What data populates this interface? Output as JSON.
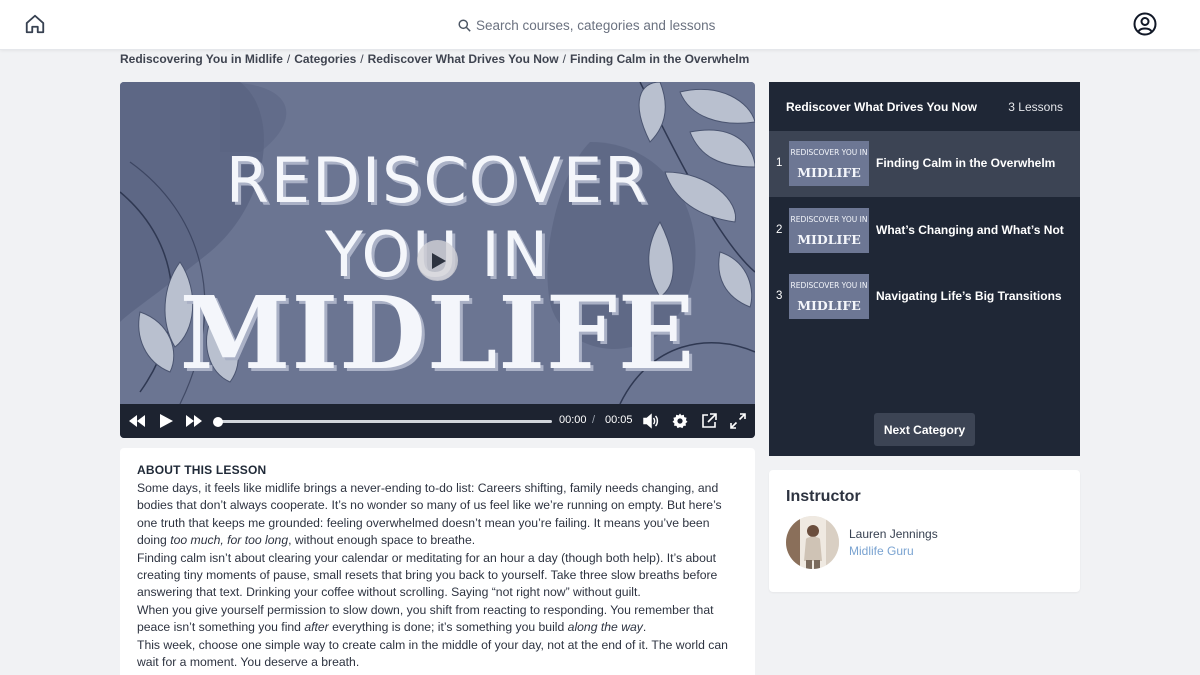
{
  "header": {
    "search_placeholder": "Search courses, categories and lessons",
    "home_icon": "home-icon",
    "account_icon": "user-circle-icon"
  },
  "breadcrumb": [
    "Rediscovering You in Midlife",
    "Categories",
    "Rediscover What Drives You Now",
    "Finding Calm in the Overwhelm"
  ],
  "video": {
    "title_line1": "REDISCOVER",
    "title_line2": "YOU IN",
    "title_line3": "MIDLIFE",
    "current_time": "00:00",
    "time_separator": "/",
    "duration": "00:05",
    "progress": 0
  },
  "about": {
    "heading": "ABOUT THIS LESSON",
    "p1_a": "Some days, it feels like midlife brings a never-ending to-do list: Careers shifting, family needs changing, and bodies that don’t always cooperate. It’s no wonder so many of us feel like we’re running on empty. But here’s one truth that keeps me grounded: feeling overwhelmed doesn’t mean you’re failing. It means you’ve been doing ",
    "p1_em": "too much, for too long",
    "p1_b": ", without enough space to breathe.",
    "p2": "Finding calm isn’t about clearing your calendar or meditating for an hour a day (though both help). It’s about creating tiny moments of pause, small resets that bring you back to yourself. Take three slow breaths before answering that text. Drinking your coffee without scrolling. Saying “not right now” without guilt.",
    "p3_a": "When you give yourself permission to slow down, you shift from reacting to responding. You remember that peace isn’t something you find ",
    "p3_em1": "after",
    "p3_b": " everything is done; it’s something you build ",
    "p3_em2": "along the way",
    "p3_c": ".",
    "p4": "This week, choose one simple way to create calm in the middle of your day, not at the end of it. The world can wait for a moment. You deserve a breath."
  },
  "lessons": {
    "title": "Rediscover What Drives You Now",
    "count": "3 Lessons",
    "items": [
      {
        "num": "1",
        "title": "Finding Calm in the Overwhelm",
        "thumb_top": "REDISCOVER YOU IN",
        "thumb_bottom": "MIDLIFE"
      },
      {
        "num": "2",
        "title": "What’s Changing and What’s Not",
        "thumb_top": "REDISCOVER YOU IN",
        "thumb_bottom": "MIDLIFE"
      },
      {
        "num": "3",
        "title": "Navigating Life’s Big Transitions",
        "thumb_top": "REDISCOVER YOU IN",
        "thumb_bottom": "MIDLIFE"
      }
    ],
    "next_label": "Next Category"
  },
  "instructor": {
    "heading": "Instructor",
    "name": "Lauren Jennings",
    "role": "Midlife Guru"
  },
  "colors": {
    "panel_dark": "#1f2736",
    "active_row": "#3c4454",
    "video_bg": "#6d7794",
    "link_blue": "#7aa3d1"
  }
}
